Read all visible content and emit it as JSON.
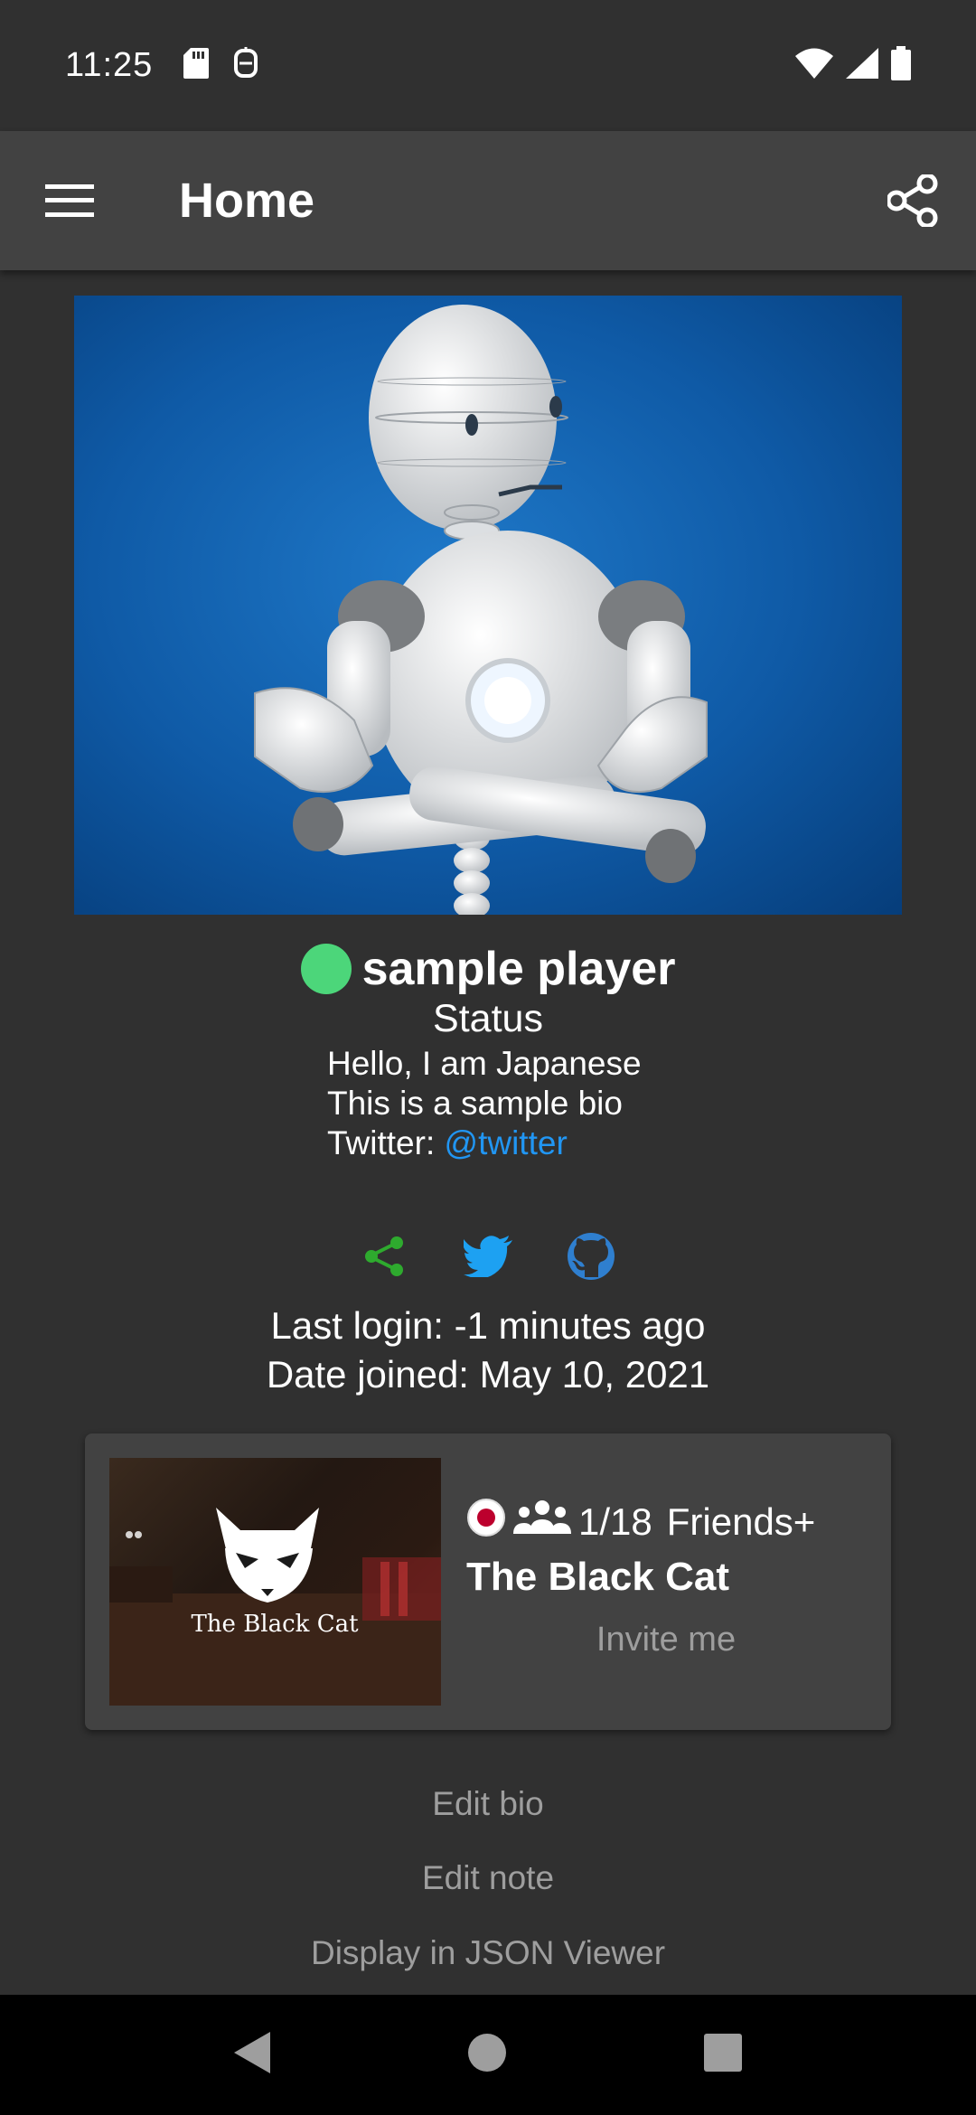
{
  "status_bar": {
    "time": "11:25"
  },
  "app_bar": {
    "title": "Home"
  },
  "profile": {
    "name": "sample player",
    "status": "Status",
    "bio_line1": "Hello, I am Japanese",
    "bio_line2": "This is a sample bio",
    "twitter_label": "Twitter: ",
    "twitter_handle": "@twitter",
    "online_color": "#4cd67a"
  },
  "social_icons": [
    "share-icon",
    "twitter-icon",
    "github-icon"
  ],
  "last_login": "Last login: -1 minutes ago",
  "date_joined": "Date joined: May 10, 2021",
  "world": {
    "thumb_label": "The Black Cat",
    "players": "1/18",
    "access": "Friends+",
    "name": "The Black Cat",
    "invite_label": "Invite me"
  },
  "actions": {
    "edit_bio": "Edit bio",
    "edit_note": "Edit note",
    "json_viewer": "Display in JSON Viewer"
  },
  "colors": {
    "link": "#2196f3",
    "share_green": "#2eaa2e",
    "twitter_blue": "#1da1f2",
    "github_blue": "#2f7fcf"
  }
}
